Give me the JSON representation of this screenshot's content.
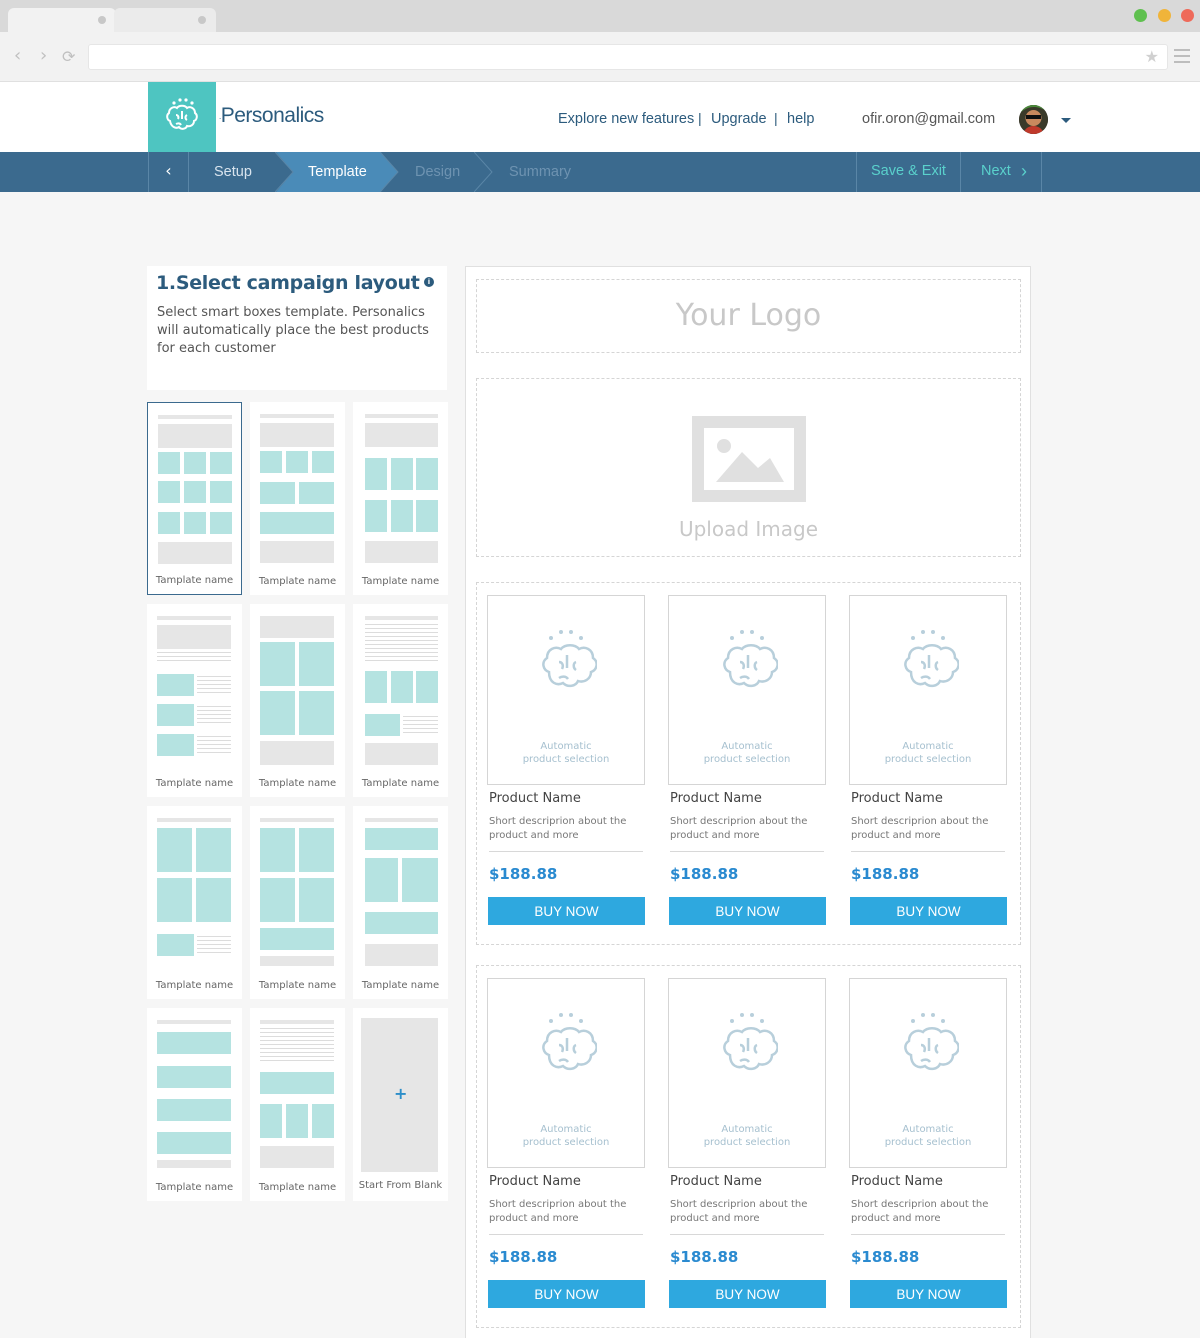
{
  "browser": {
    "address": ""
  },
  "brand": {
    "name": "Personalics"
  },
  "header": {
    "links": [
      "Explore new features",
      "Upgrade",
      "help"
    ],
    "separator": "|",
    "email": "ofir.oron@gmail.com"
  },
  "wizard": {
    "back_icon": "chevron-left-icon",
    "steps": [
      "Setup",
      "Template",
      "Design",
      "Summary"
    ],
    "active_step": "Template",
    "save_exit": "Save & Exit",
    "next": "Next"
  },
  "panel": {
    "title": "1.Select campaign layout",
    "info_glyph": "i",
    "description": "Select smart boxes template. Personalics will automatically place the best products for each customer"
  },
  "templates": [
    {
      "name": "Tamplate name",
      "selected": true
    },
    {
      "name": "Tamplate name"
    },
    {
      "name": "Tamplate name"
    },
    {
      "name": "Tamplate name"
    },
    {
      "name": "Tamplate name"
    },
    {
      "name": "Tamplate name"
    },
    {
      "name": "Tamplate name"
    },
    {
      "name": "Tamplate name"
    },
    {
      "name": "Tamplate name"
    },
    {
      "name": "Tamplate name"
    },
    {
      "name": "Tamplate name"
    },
    {
      "name": "Start From Blank",
      "plus": "+"
    }
  ],
  "preview": {
    "logo_placeholder": "Your Logo",
    "upload_text": "Upload Image",
    "rows": [
      {
        "products": [
          {
            "auto_line1": "Automatic",
            "auto_line2": "product selection",
            "name": "Product Name",
            "description": "Short descriprion about the product and more",
            "price": "$188.88",
            "button": "BUY NOW"
          },
          {
            "auto_line1": "Automatic",
            "auto_line2": "product selection",
            "name": "Product Name",
            "description": "Short descriprion about the product and more",
            "price": "$188.88",
            "button": "BUY NOW"
          },
          {
            "auto_line1": "Automatic",
            "auto_line2": "product selection",
            "name": "Product Name",
            "description": "Short descriprion about the product and more",
            "price": "$188.88",
            "button": "BUY NOW"
          }
        ]
      },
      {
        "products": [
          {
            "auto_line1": "Automatic",
            "auto_line2": "product selection",
            "name": "Product Name",
            "description": "Short descriprion about the product and more",
            "price": "$188.88",
            "button": "BUY NOW"
          },
          {
            "auto_line1": "Automatic",
            "auto_line2": "product selection",
            "name": "Product Name",
            "description": "Short descriprion about the product and more",
            "price": "$188.88",
            "button": "BUY NOW"
          },
          {
            "auto_line1": "Automatic",
            "auto_line2": "product selection",
            "name": "Product Name",
            "description": "Short descriprion about the product and more",
            "price": "$188.88",
            "button": "BUY NOW"
          }
        ]
      }
    ]
  },
  "colors": {
    "brand_teal": "#4ec5c1",
    "navy": "#2c5b7d",
    "wizard_bg": "#3b6a8e",
    "active_step": "#4a8bb8",
    "accent_teal": "#5ad1cc",
    "buy_button": "#2ea8df",
    "price": "#2a8ad0"
  }
}
